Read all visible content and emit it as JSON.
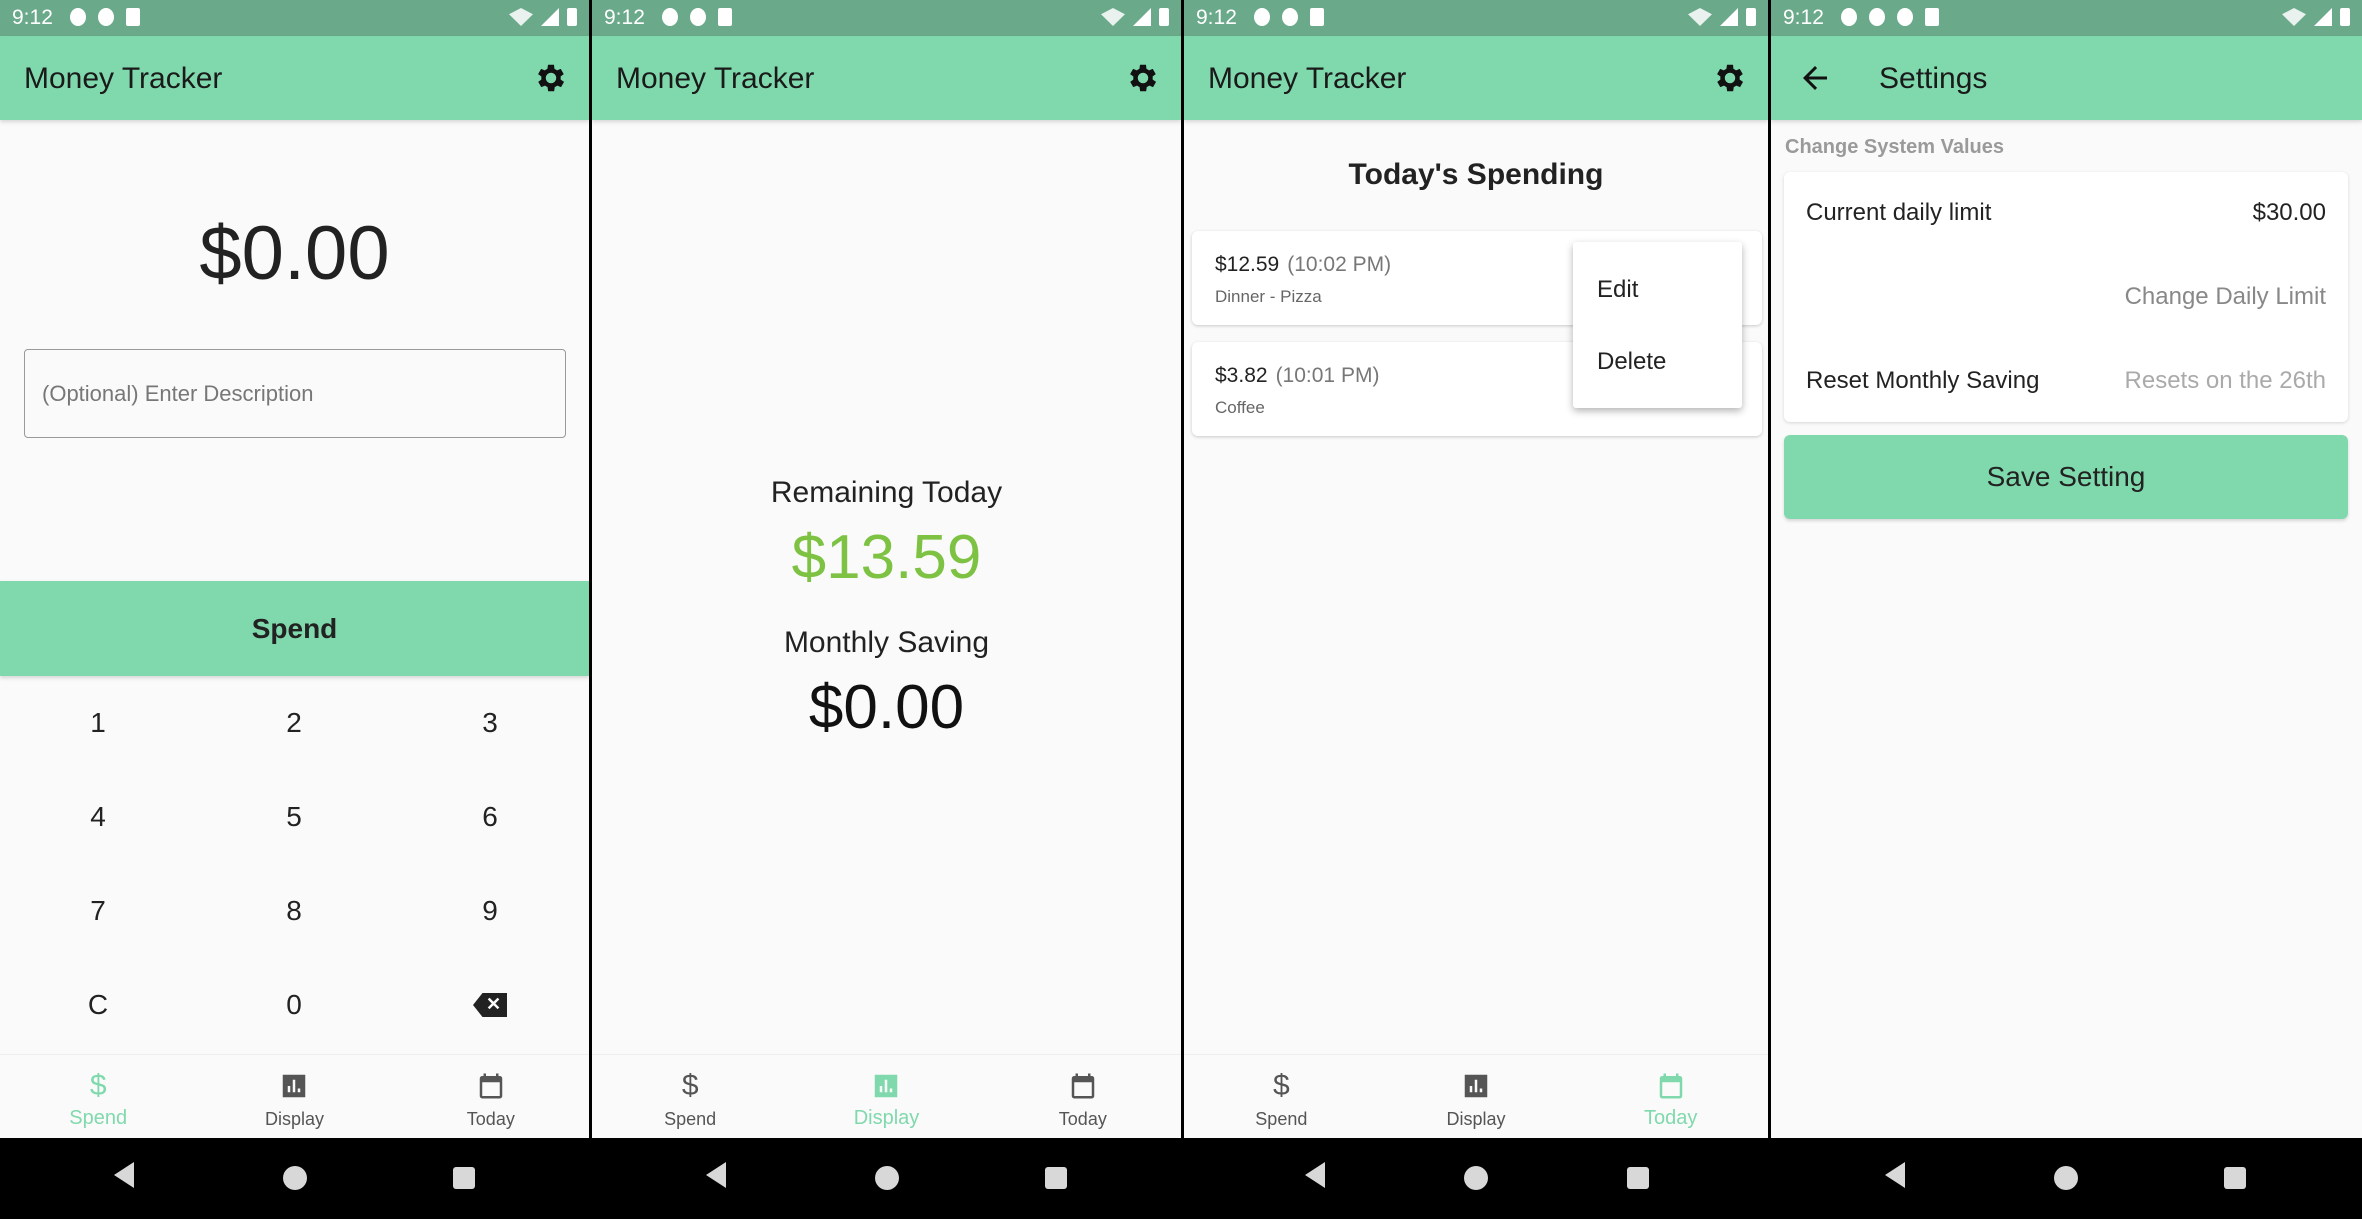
{
  "status_bar": {
    "time": "9:12"
  },
  "app": {
    "title": "Money Tracker"
  },
  "bottom_nav": {
    "spend": "Spend",
    "display": "Display",
    "today": "Today",
    "spend_symbol": "$"
  },
  "spend_screen": {
    "amount": "$0.00",
    "description_placeholder": "(Optional) Enter Description",
    "spend_button": "Spend",
    "keys": [
      "1",
      "2",
      "3",
      "4",
      "5",
      "6",
      "7",
      "8",
      "9",
      "C",
      "0"
    ]
  },
  "display_screen": {
    "remaining_label": "Remaining Today",
    "remaining_value": "$13.59",
    "monthly_label": "Monthly Saving",
    "monthly_value": "$0.00"
  },
  "today_screen": {
    "title": "Today's Spending",
    "entries": [
      {
        "amount": "$12.59",
        "time": "(10:02 PM)",
        "description": "Dinner - Pizza"
      },
      {
        "amount": "$3.82",
        "time": "(10:01 PM)",
        "description": "Coffee"
      }
    ],
    "menu": {
      "edit": "Edit",
      "delete": "Delete"
    }
  },
  "settings_screen": {
    "title": "Settings",
    "section": "Change System Values",
    "daily_limit_label": "Current daily limit",
    "daily_limit_value": "$30.00",
    "change_limit": "Change Daily Limit",
    "reset_label": "Reset Monthly Saving",
    "reset_value": "Resets on the 26th",
    "save_button": "Save Setting"
  },
  "colors": {
    "accent": "#80d9ad",
    "status_bar": "#6aa98a",
    "positive": "#7dc242"
  },
  "icons": [
    "gear-icon",
    "back-arrow-icon",
    "dollar-icon",
    "chart-icon",
    "calendar-icon",
    "backspace-icon"
  ]
}
